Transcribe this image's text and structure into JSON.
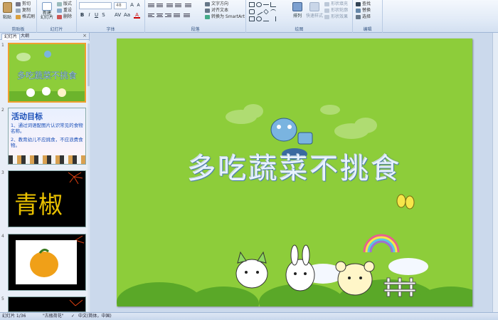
{
  "ribbon": {
    "clipboard": {
      "paste": "粘贴",
      "cut": "剪切",
      "copy": "复制",
      "format_painter": "格式刷",
      "label": "剪贴板"
    },
    "slides": {
      "new_slide": "新建\n幻灯片",
      "layout": "版式",
      "reset": "重设",
      "delete": "删除",
      "label": "幻灯片"
    },
    "font": {
      "font_size": "48",
      "label": "字体"
    },
    "paragraph": {
      "text_direction": "文字方向",
      "align_text": "对齐文本",
      "convert_smartart": "转换为 SmartArt",
      "label": "段落"
    },
    "drawing": {
      "arrange": "排列",
      "quick_styles": "快速样式",
      "shape_fill": "形状填充",
      "shape_outline": "形状轮廓",
      "shape_effects": "形状效果",
      "label": "绘图"
    },
    "editing": {
      "find": "查找",
      "replace": "替换",
      "select": "选择",
      "label": "编辑"
    }
  },
  "panel": {
    "tabs": [
      "幻灯片",
      "大纲"
    ],
    "close": "×",
    "slides": [
      {
        "number": "1",
        "title": "多吃蔬菜不挑食"
      },
      {
        "number": "2",
        "heading": "活动目标",
        "line1": "1、通过词语配图片认识常见的食物名称。",
        "line2": "2、教育幼儿不应挑食，不应浪费食物。"
      },
      {
        "number": "3",
        "text": "青椒"
      },
      {
        "number": "4"
      },
      {
        "number": "5"
      }
    ]
  },
  "slide": {
    "title": "多吃蔬菜不挑食"
  },
  "status": {
    "slide_info": "幻灯片 1/36",
    "theme": "\"古瓶荷花\"",
    "language": "中文(简体，中国)"
  },
  "colors": {
    "slide_bg": "#8dcd3a",
    "ribbon_bg": "#e2ebf7",
    "selected_border": "#f0a030"
  }
}
